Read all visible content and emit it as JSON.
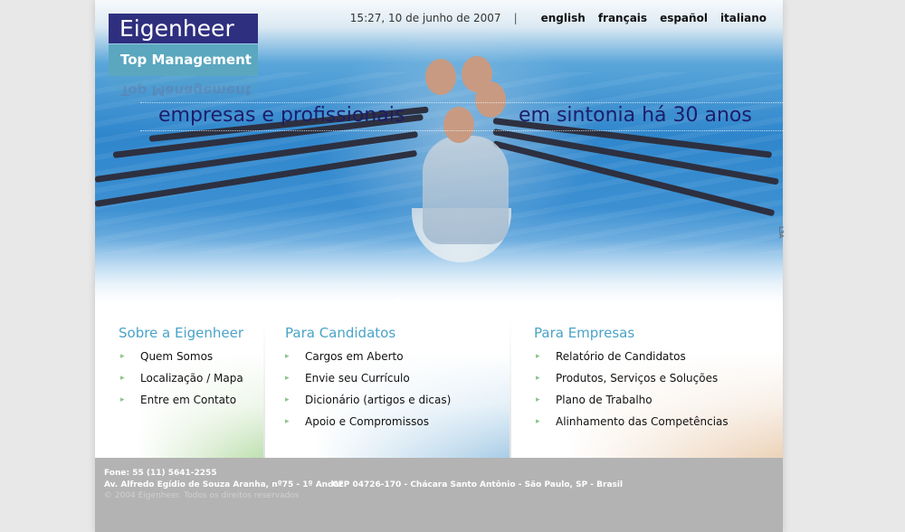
{
  "logo": {
    "top": "Eigenheer",
    "bottom": "Top Management",
    "reflection": "Top Management"
  },
  "header": {
    "datetime": "15:27, 10 de junho de 2007",
    "separator": "|",
    "languages": [
      "english",
      "français",
      "español",
      "italiano"
    ]
  },
  "hero": {
    "tagline_left": "empresas e profissionais",
    "tagline_right": "em sintonia há 30 anos"
  },
  "sections": [
    {
      "title": "Sobre a Eigenheer",
      "items": [
        "Quem Somos",
        "Localização / Mapa",
        "Entre em Contato"
      ]
    },
    {
      "title": "Para Candidatos",
      "items": [
        "Cargos em Aberto",
        "Envie seu Currículo",
        "Dicionário (artigos e dicas)",
        "Apoio e Compromissos"
      ]
    },
    {
      "title": "Para Empresas",
      "items": [
        "Relatório de Candidatos",
        "Produtos, Serviços e Soluções",
        "Plano de Trabalho",
        "Alinhamento das Competências"
      ]
    }
  ],
  "footer": {
    "phone": "Fone: 55 (11) 5641-2255",
    "address": "Av. Alfredo Egídio de Souza Aranha, nº75 - 1º Andar",
    "cep": "CEP 04726-170 - Chácara Santo Antônio - São Paulo, SP - Brasil",
    "copyright": "© 2004 Eigenheer. Todos os direitos reservados"
  },
  "side_mark": "L3A",
  "colors": {
    "brand_navy": "#2e2f7f",
    "brand_teal": "#5aa7bf",
    "section_title": "#4aa3c8",
    "footer_bg": "#b3b3b3"
  }
}
